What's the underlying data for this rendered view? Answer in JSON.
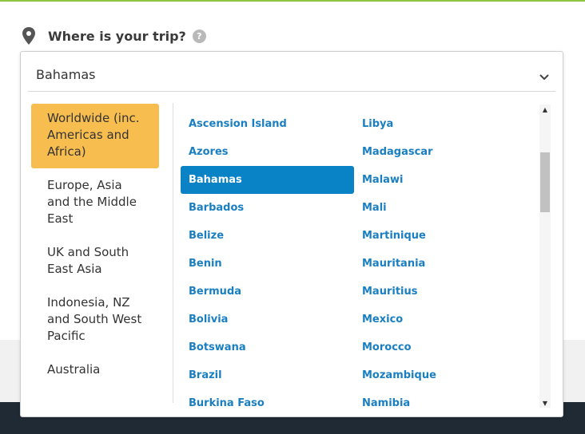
{
  "question": {
    "label": "Where is your trip?",
    "help": "?"
  },
  "destination_select": {
    "value": "Bahamas"
  },
  "regions": [
    {
      "label": "Worldwide (inc. Americas and Africa)",
      "active": true
    },
    {
      "label": "Europe, Asia and the Middle East",
      "active": false
    },
    {
      "label": "UK and South East Asia",
      "active": false
    },
    {
      "label": "Indonesia, NZ and South West Pacific",
      "active": false
    },
    {
      "label": "Australia",
      "active": false
    }
  ],
  "countries_left": [
    "Ascension Island",
    "Azores",
    "Bahamas",
    "Barbados",
    "Belize",
    "Benin",
    "Bermuda",
    "Bolivia",
    "Botswana",
    "Brazil",
    "Burkina Faso"
  ],
  "countries_right": [
    "Libya",
    "Madagascar",
    "Malawi",
    "Mali",
    "Martinique",
    "Mauritania",
    "Mauritius",
    "Mexico",
    "Morocco",
    "Mozambique",
    "Namibia"
  ],
  "selected_country": "Bahamas",
  "scrollbar": {
    "up_glyph": "▲",
    "down_glyph": "▼"
  },
  "colors": {
    "accent_green": "#8dc63f",
    "region_active": "#f7be4f",
    "country_link": "#1a7fc1",
    "country_selected": "#0a82c6",
    "footer": "#1f2a35"
  },
  "icons": {
    "location": "map-pin-icon",
    "help": "question-circle-icon",
    "dropdown": "chevron-down-icon"
  }
}
